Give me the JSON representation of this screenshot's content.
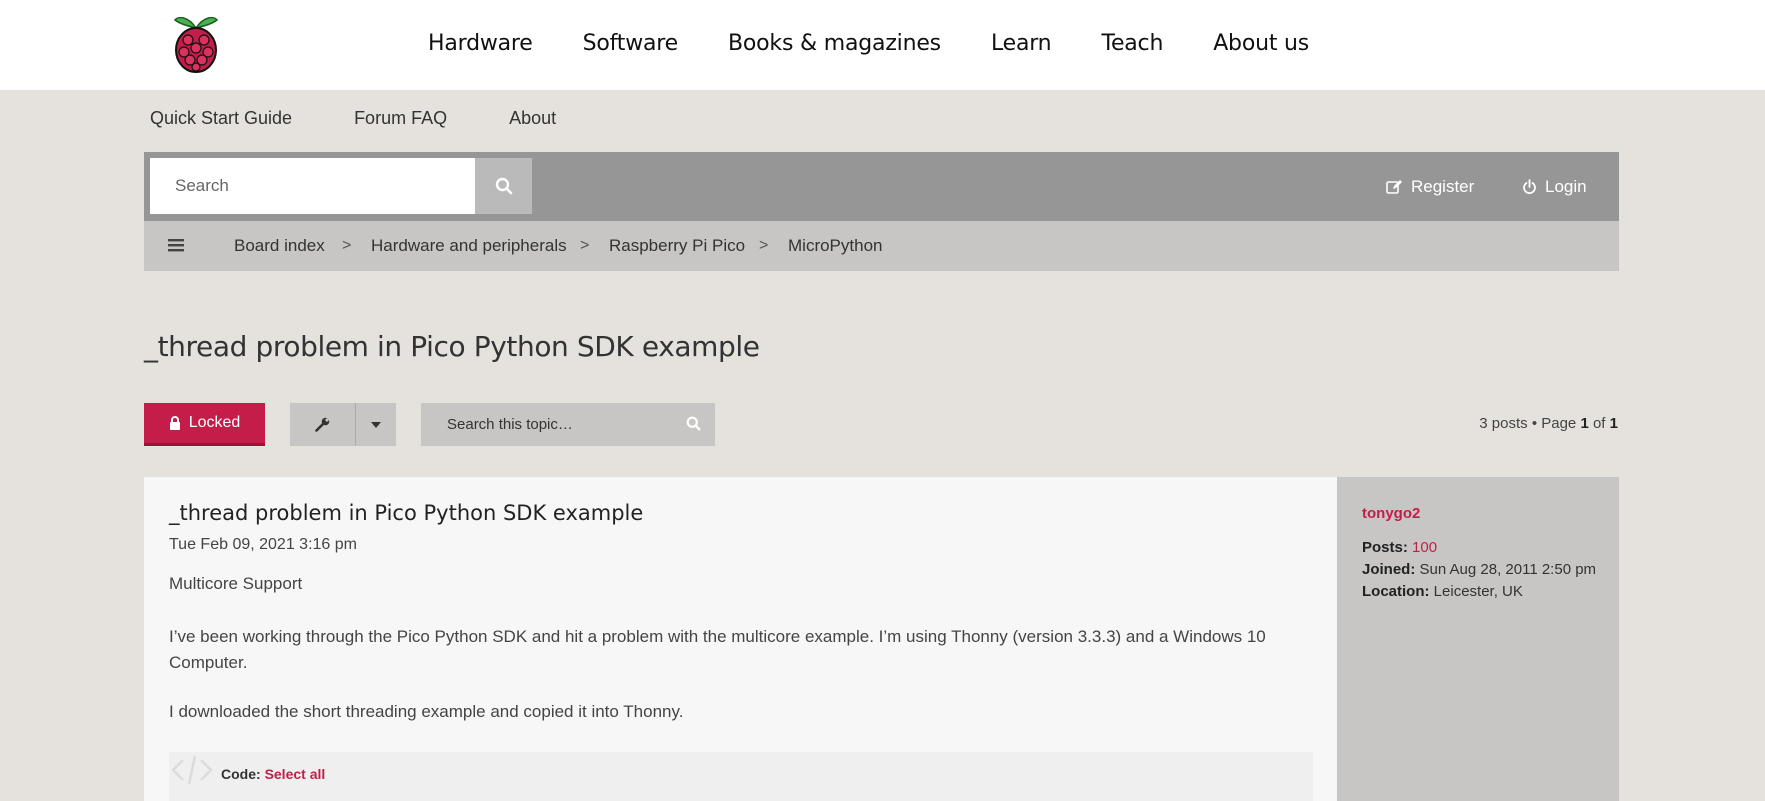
{
  "header": {
    "nav": [
      "Hardware",
      "Software",
      "Books & magazines",
      "Learn",
      "Teach",
      "About us"
    ]
  },
  "sublinks": [
    "Quick Start Guide",
    "Forum FAQ",
    "About"
  ],
  "search": {
    "placeholder": "Search"
  },
  "account": {
    "register": "Register",
    "login": "Login"
  },
  "breadcrumbs": [
    "Board index",
    "Hardware and peripherals",
    "Raspberry Pi Pico",
    "MicroPython"
  ],
  "breadcrumb_separator": ">",
  "topic": {
    "title": "_thread problem in Pico Python SDK example",
    "locked_label": "Locked",
    "search_placeholder": "Search this topic…",
    "page_info": {
      "posts": "3 posts • Page ",
      "page": "1",
      "of": " of ",
      "total": "1"
    }
  },
  "post": {
    "title": "_thread problem in Pico Python SDK example",
    "date": "Tue Feb 09, 2021 3:16 pm",
    "paragraphs": [
      "Multicore Support",
      "I’ve been working through the Pico Python SDK and hit a problem with the multicore example. I’m using Thonny (version 3.3.3) and a Windows 10 Computer.",
      "I downloaded the short threading example and copied it into Thonny."
    ],
    "code_label": "Code: ",
    "select_all": "Select all"
  },
  "author": {
    "username": "tonygo2",
    "posts_label": "Posts:",
    "posts": "100",
    "joined_label": "Joined:",
    "joined": "Sun Aug 28, 2011 2:50 pm",
    "location_label": "Location:",
    "location": "Leicester, UK"
  },
  "colors": {
    "accent": "#c51d4a",
    "bar": "#979696",
    "breadcrumb_bg": "#c7c6c5",
    "page_bg": "#e5e2de"
  }
}
